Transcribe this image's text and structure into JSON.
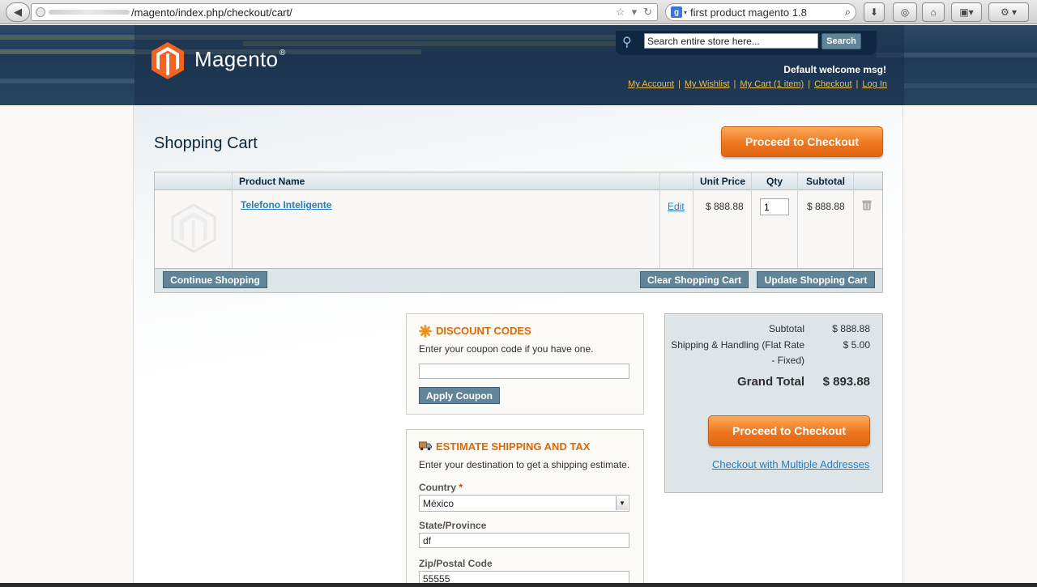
{
  "browser": {
    "url_text": "/magento/index.php/checkout/cart/",
    "search_text": "first product magento 1.8",
    "search_engine_badge": "g"
  },
  "header": {
    "logo_text": "Magento",
    "logo_reg": "®",
    "search_placeholder": "Search entire store here...",
    "search_button": "Search",
    "welcome": "Default welcome msg!",
    "links": [
      "My Account",
      "My Wishlist",
      "My Cart (1 item)",
      "Checkout",
      "Log In"
    ]
  },
  "cart": {
    "title": "Shopping Cart",
    "proceed_top": "Proceed to Checkout",
    "columns": [
      "Product Name",
      "Unit Price",
      "Qty",
      "Subtotal"
    ],
    "items": [
      {
        "name": "Telefono Inteligente",
        "edit": "Edit",
        "unit_price": "$ 888.88",
        "qty": "1",
        "subtotal": "$ 888.88"
      }
    ],
    "continue_button": "Continue Shopping",
    "clear_button": "Clear Shopping Cart",
    "update_button": "Update Shopping Cart"
  },
  "discount": {
    "title": "DISCOUNT CODES",
    "text": "Enter your coupon code if you have one.",
    "input_value": "",
    "apply_button": "Apply Coupon"
  },
  "shipping": {
    "title": "ESTIMATE SHIPPING AND TAX",
    "text": "Enter your destination to get a shipping estimate.",
    "country_label": "Country",
    "required_mark": "*",
    "country_value": "México",
    "state_label": "State/Province",
    "state_value": "df",
    "zip_label": "Zip/Postal Code",
    "zip_value": "55555"
  },
  "totals": {
    "subtotal_label": "Subtotal",
    "subtotal_value": "$ 888.88",
    "shipping_label_line1": "Shipping & Handling (Flat Rate",
    "shipping_label_line2": "- Fixed)",
    "shipping_value": "$ 5.00",
    "grand_label": "Grand Total",
    "grand_value": "$ 893.88",
    "proceed_bottom": "Proceed to Checkout",
    "multi_link": "Checkout with Multiple Addresses"
  },
  "colors": {
    "accent_orange": "#ee7720",
    "link_blue": "#1e7ec8",
    "header_navy": "#1f3a57",
    "button_grey_blue": "#618499",
    "header_link_gold": "#ebbc4e"
  }
}
